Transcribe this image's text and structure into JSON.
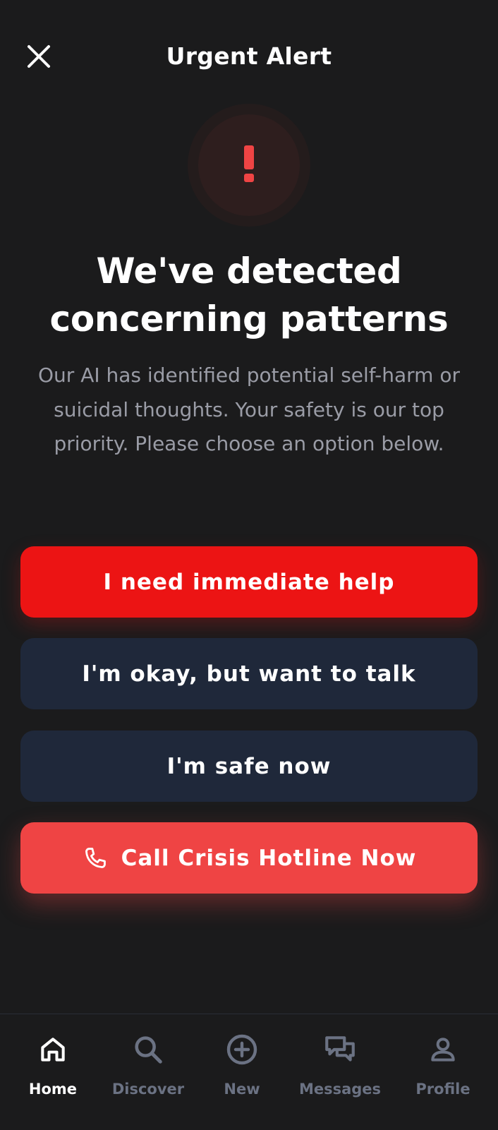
{
  "header": {
    "title": "Urgent Alert",
    "close_icon": "close-icon"
  },
  "alert": {
    "icon": "exclamation-icon",
    "symbol": "!",
    "color": "#ef4444"
  },
  "headline": {
    "line1": "We've detected",
    "line2": "concerning patterns"
  },
  "description": "Our AI has identified potential self-harm or suicidal thoughts. Your safety is our top priority. Please choose an option below.",
  "options": {
    "immediate_help": "I need immediate help",
    "want_to_talk": "I'm okay, but want to talk",
    "safe_now": "I'm safe now",
    "hotline": "Call Crisis Hotline Now",
    "hotline_icon": "phone-icon"
  },
  "colors": {
    "primary_red": "#ec1414",
    "hotline_red": "#ef4444",
    "secondary_button": "#1f283a",
    "background": "#1b1b1c",
    "muted_text": "#9a9ca6"
  },
  "nav": {
    "items": [
      {
        "label": "Home",
        "icon": "home-icon",
        "active": true
      },
      {
        "label": "Discover",
        "icon": "search-icon",
        "active": false
      },
      {
        "label": "New",
        "icon": "plus-circle-icon",
        "active": false
      },
      {
        "label": "Messages",
        "icon": "messages-icon",
        "active": false
      },
      {
        "label": "Profile",
        "icon": "profile-icon",
        "active": false
      }
    ]
  }
}
